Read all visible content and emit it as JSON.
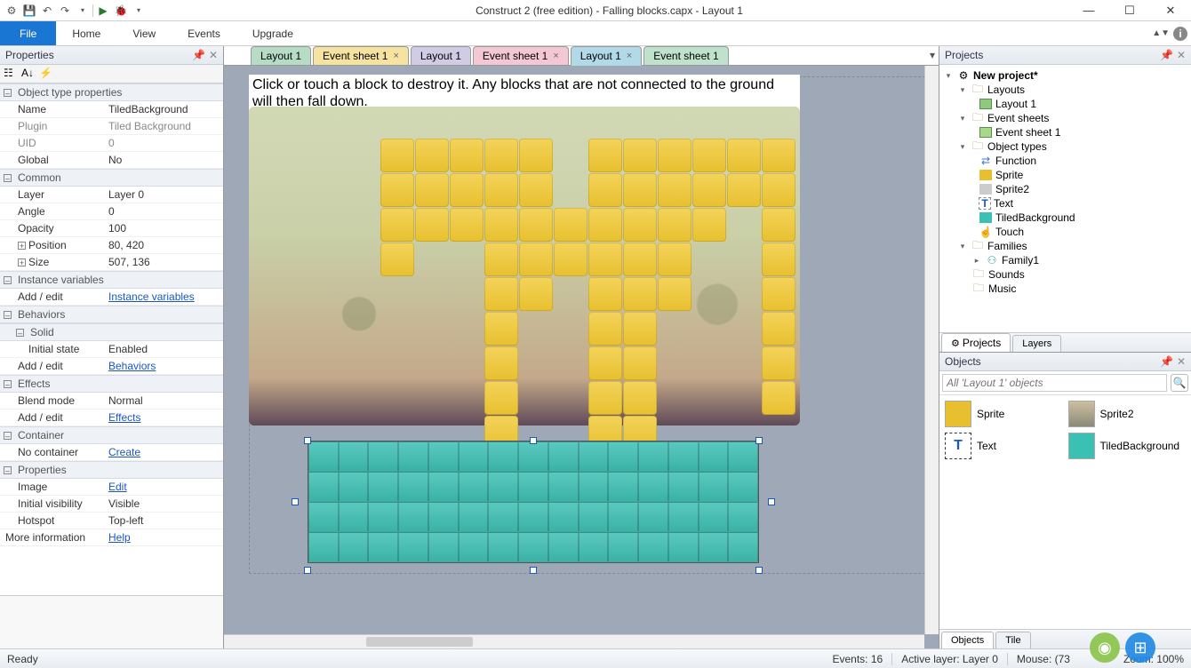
{
  "title": "Construct 2  (free edition) - Falling blocks.capx - Layout 1",
  "menu": {
    "file": "File",
    "home": "Home",
    "view": "View",
    "events": "Events",
    "upgrade": "Upgrade"
  },
  "tabs": [
    {
      "label": "Layout 1",
      "cls": "c1"
    },
    {
      "label": "Event sheet 1",
      "cls": "c2",
      "close": true
    },
    {
      "label": "Layout 1",
      "cls": "c3"
    },
    {
      "label": "Event sheet 1",
      "cls": "c4",
      "close": true
    },
    {
      "label": "Layout 1",
      "cls": "c5",
      "close": true
    },
    {
      "label": "Event sheet 1",
      "cls": "c6"
    }
  ],
  "properties": {
    "title": "Properties",
    "sections": {
      "objtype": "Object type properties",
      "common": "Common",
      "instvars": "Instance variables",
      "behaviors": "Behaviors",
      "solid": "Solid",
      "effects": "Effects",
      "container": "Container",
      "props": "Properties"
    },
    "rows": {
      "name_l": "Name",
      "name_v": "TiledBackground",
      "plugin_l": "Plugin",
      "plugin_v": "Tiled Background",
      "uid_l": "UID",
      "uid_v": "0",
      "global_l": "Global",
      "global_v": "No",
      "layer_l": "Layer",
      "layer_v": "Layer 0",
      "angle_l": "Angle",
      "angle_v": "0",
      "opacity_l": "Opacity",
      "opacity_v": "100",
      "position_l": "Position",
      "position_v": "80, 420",
      "size_l": "Size",
      "size_v": "507, 136",
      "addedit": "Add / edit",
      "instvars_link": "Instance variables",
      "initstate_l": "Initial state",
      "initstate_v": "Enabled",
      "behaviors_link": "Behaviors",
      "blend_l": "Blend mode",
      "blend_v": "Normal",
      "effects_link": "Effects",
      "nocontainer_l": "No container",
      "create_link": "Create",
      "image_l": "Image",
      "edit_link": "Edit",
      "initvis_l": "Initial visibility",
      "initvis_v": "Visible",
      "hotspot_l": "Hotspot",
      "hotspot_v": "Top-left",
      "moreinfo_l": "More information",
      "help_link": "Help"
    }
  },
  "layout_text": "Click or touch a block to destroy it. Any blocks that are not connected to the ground will then fall down.",
  "projects": {
    "title": "Projects",
    "root": "New project*",
    "layouts": "Layouts",
    "layout1": "Layout 1",
    "eventsheets": "Event sheets",
    "eventsheet1": "Event sheet 1",
    "objtypes": "Object types",
    "function": "Function",
    "sprite": "Sprite",
    "sprite2": "Sprite2",
    "text": "Text",
    "tiledbg": "TiledBackground",
    "touch": "Touch",
    "families": "Families",
    "family1": "Family1",
    "sounds": "Sounds",
    "music": "Music",
    "tab_projects": "Projects",
    "tab_layers": "Layers"
  },
  "objects": {
    "title": "Objects",
    "filter_placeholder": "All 'Layout 1' objects",
    "sprite": "Sprite",
    "sprite2": "Sprite2",
    "text": "Text",
    "tiledbg": "TiledBackground",
    "tab_objects": "Objects",
    "tab_tile": "Tile"
  },
  "status": {
    "ready": "Ready",
    "events": "Events: 16",
    "layer": "Active layer: Layer 0",
    "mouse": "Mouse: (73",
    "zoom": "Zoom: 100%"
  }
}
